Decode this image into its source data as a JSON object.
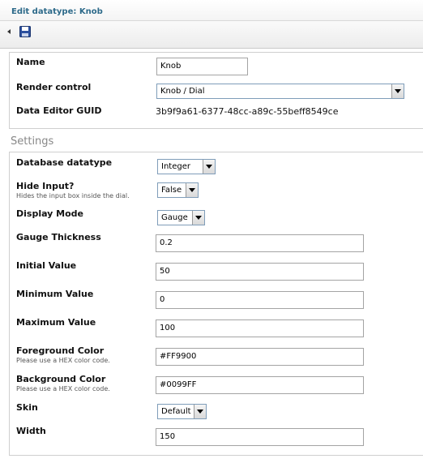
{
  "window": {
    "title": "Edit datatype: Knob"
  },
  "toolbar": {
    "icons": [
      "arrow-left-icon",
      "save-icon"
    ]
  },
  "general": {
    "name_label": "Name",
    "name_value": "Knob",
    "render_label": "Render control",
    "render_value": "Knob / Dial",
    "guid_label": "Data Editor GUID",
    "guid_value": "3b9f9a61-6377-48cc-a89c-55beff8549ce"
  },
  "settings": {
    "title": "Settings",
    "db_type_label": "Database datatype",
    "db_type_value": "Integer",
    "hide_input_label": "Hide Input?",
    "hide_input_desc": "Hides the input box inside the dial.",
    "hide_input_value": "False",
    "display_mode_label": "Display Mode",
    "display_mode_value": "Gauge",
    "gauge_thickness_label": "Gauge Thickness",
    "gauge_thickness_value": "0.2",
    "initial_label": "Initial Value",
    "initial_value": "50",
    "min_label": "Minimum Value",
    "min_value": "0",
    "max_label": "Maximum Value",
    "max_value": "100",
    "fg_label": "Foreground Color",
    "fg_desc": "Please use a HEX color code.",
    "fg_value": "#FF9900",
    "bg_label": "Background Color",
    "bg_desc": "Please use a HEX color code.",
    "bg_value": "#0099FF",
    "skin_label": "Skin",
    "skin_value": "Default",
    "width_label": "Width",
    "width_value": "150"
  }
}
